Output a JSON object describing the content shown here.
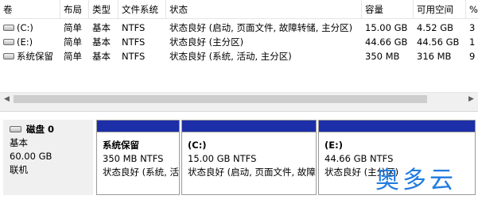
{
  "columns": [
    "卷",
    "布局",
    "类型",
    "文件系统",
    "状态",
    "容量",
    "可用空间",
    "%"
  ],
  "volumes": [
    {
      "name": "(C:)",
      "layout": "简单",
      "type": "基本",
      "fs": "NTFS",
      "status": "状态良好 (启动, 页面文件, 故障转储, 主分区)",
      "capacity": "15.00 GB",
      "free": "4.52 GB",
      "pct": "3"
    },
    {
      "name": "(E:)",
      "layout": "简单",
      "type": "基本",
      "fs": "NTFS",
      "status": "状态良好 (主分区)",
      "capacity": "44.66 GB",
      "free": "44.56 GB",
      "pct": "1"
    },
    {
      "name": "系统保留",
      "layout": "简单",
      "type": "基本",
      "fs": "NTFS",
      "status": "状态良好 (系统, 活动, 主分区)",
      "capacity": "350 MB",
      "free": "316 MB",
      "pct": "9"
    }
  ],
  "disk": {
    "title": "磁盘 0",
    "type": "基本",
    "size": "60.00 GB",
    "state": "联机"
  },
  "partitions": [
    {
      "name": "系统保留",
      "size_fs": "350 MB NTFS",
      "status": "状态良好 (系统, 活"
    },
    {
      "name": "(C:)",
      "size_fs": "15.00 GB NTFS",
      "status": "状态良好 (启动, 页面文件, 故障"
    },
    {
      "name": "(E:)",
      "size_fs": "44.66 GB NTFS",
      "status": "状态良好 (主分区)"
    }
  ],
  "watermark": "奥多云",
  "colors": {
    "partition_bar": "#1c2fa8",
    "watermark": "#1f7be0"
  },
  "icons": {
    "volume": "drive-icon",
    "disk": "disk-icon",
    "scroll_left": "arrow-left-icon",
    "scroll_right": "arrow-right-icon"
  }
}
